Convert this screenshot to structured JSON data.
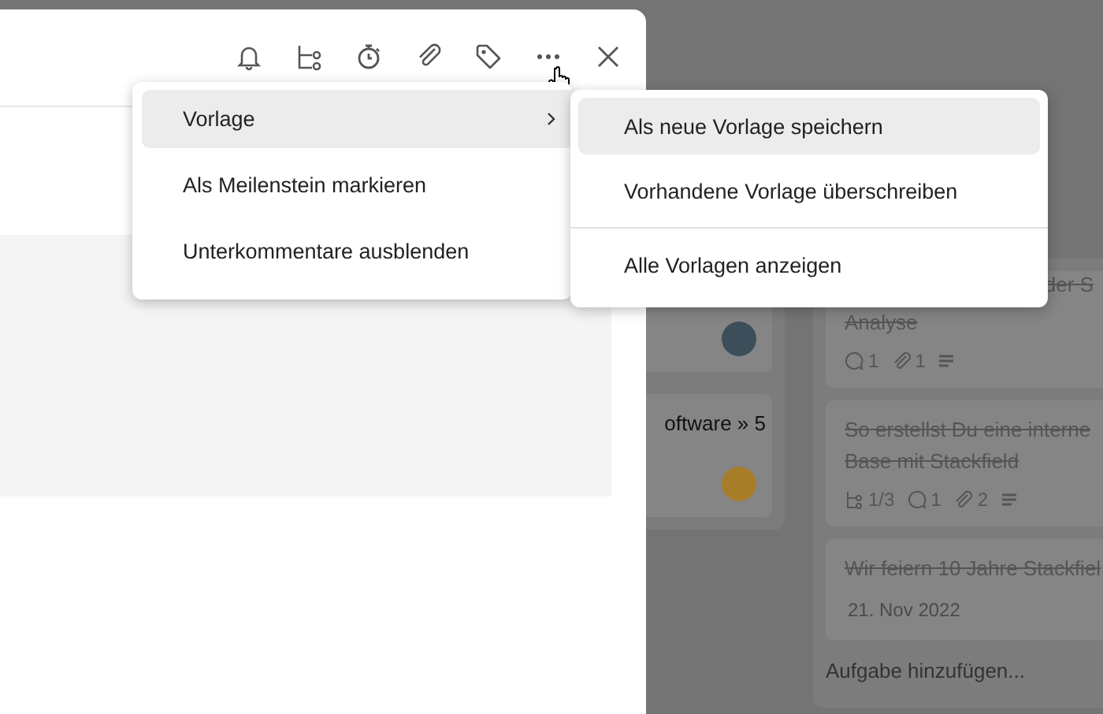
{
  "board": {
    "columns": [
      {
        "cards": [
          {
            "avatar": true
          },
          {
            "title_lines": [
              "oftware » 5"
            ],
            "avatar": true
          }
        ]
      },
      {
        "cards": [
          {
            "title_lines": [
              "der S",
              "Analyse"
            ],
            "done": true,
            "meta": [
              {
                "kind": "comments",
                "text": "1"
              },
              {
                "kind": "attachments",
                "text": "1"
              },
              {
                "kind": "description"
              }
            ]
          },
          {
            "title_lines": [
              "So erstellst Du eine interne",
              "Base mit Stackfield"
            ],
            "done": true,
            "meta": [
              {
                "kind": "subtasks",
                "text": "1/3"
              },
              {
                "kind": "comments",
                "text": "1"
              },
              {
                "kind": "attachments",
                "text": "2"
              },
              {
                "kind": "description"
              }
            ]
          },
          {
            "title_lines": [
              "Wir feiern 10 Jahre Stackfiel"
            ],
            "done": true,
            "date": "21. Nov 2022"
          }
        ],
        "add_task": "Aufgabe hinzufügen..."
      }
    ]
  },
  "toolbar": {
    "icons": [
      {
        "kind": "bell"
      },
      {
        "kind": "subtasks"
      },
      {
        "kind": "timer"
      },
      {
        "kind": "attachment"
      },
      {
        "kind": "tag"
      },
      {
        "kind": "more"
      },
      {
        "kind": "close"
      }
    ]
  },
  "menu": {
    "items": [
      {
        "label": "Vorlage",
        "selected": true,
        "submenu": true
      },
      {
        "label": "Als Meilenstein markieren",
        "selected": false,
        "submenu": false
      },
      {
        "label": "Unterkommentare ausblenden",
        "selected": false,
        "submenu": false
      }
    ]
  },
  "submenu": {
    "items": [
      {
        "label": "Als neue Vorlage speichern",
        "selected": true,
        "divider_before": false
      },
      {
        "label": "Vorhandene Vorlage überschreiben",
        "selected": false,
        "divider_before": false
      },
      {
        "label": "Alle Vorlagen anzeigen",
        "selected": false,
        "divider_before": true
      }
    ]
  }
}
